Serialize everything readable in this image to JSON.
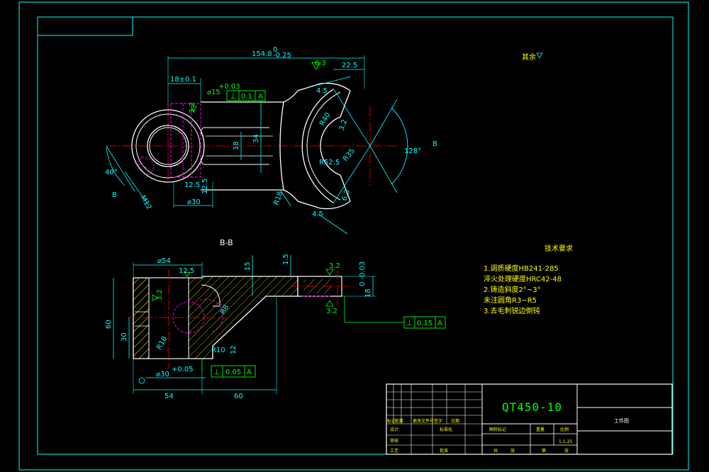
{
  "drawing": {
    "dims_top": {
      "total_length": "154.8",
      "total_length_tol": "0\n-0.25",
      "tol_upper": "0",
      "tol_lower": "-0.25",
      "right_22": "22.5",
      "bore_offset": "18±0.1",
      "bore_dia": "⌀15",
      "bore_tol": "+0.03",
      "perp_sym": "⊥",
      "perp_val": "0.1",
      "perp_ref": "A",
      "r45_top": "4.5",
      "r45_bot": "4.5",
      "r40": "R40",
      "r32": "3.2",
      "r52": "R52.5",
      "r35": "R35",
      "r63": "6.3",
      "r18": "R18",
      "d34": "34",
      "d18": "18",
      "angle128": "128°",
      "angle40": "40°",
      "m12": "M12",
      "b_left": "B",
      "b_right": "B",
      "dim125": "12.5",
      "dim125b": "12.5",
      "dim30": "⌀30",
      "rough63": "6.3",
      "rough32a": "3.2",
      "rough_top": "其余"
    },
    "section": {
      "label": "B-B",
      "d54": "⌀54",
      "d125": "12.5",
      "d15": "15",
      "d15b": "1.5",
      "d32a": "3.2",
      "d32b": "3.2",
      "d32c": "3.2",
      "d18": "18",
      "d18tol": "0\n-0.03",
      "r8": "R8",
      "r18": "R18",
      "r10": "R10",
      "d12": "12",
      "d60v": "60",
      "d30v": "30",
      "d30dia": "⌀30",
      "d30tol": "+0.05",
      "perp1_val": "0.15",
      "perp1_ref": "A",
      "perp2_val": "0.05",
      "perp2_ref": "A",
      "d54h": "54",
      "d60h": "60"
    },
    "tech_req": {
      "title": "技术要求",
      "lines": [
        "1.调质硬度HB241-285",
        "  淬火处理硬度HRC42-48",
        "2.铸造斜度2°~3°",
        "  未注圆角R3~R5",
        "3.去毛刺锐边倒钝"
      ]
    },
    "title_block": {
      "material": "QT450-10",
      "name": "工件图",
      "scale": "1:1.25",
      "cells": [
        "标记",
        "处数",
        "更改文件号",
        "签字",
        "日期",
        "设计",
        "标准化",
        "审核",
        "工艺",
        "批准",
        "图样标记",
        "重量",
        "比例",
        "共",
        "张",
        "第",
        "张"
      ]
    }
  },
  "colors": {
    "frame": "#00ffff",
    "dim": "#00ff00",
    "outline": "#ffffff",
    "center": "#ff0000",
    "hidden": "#ff00ff",
    "hatch": "#ffff00",
    "note": "#ffff00"
  }
}
